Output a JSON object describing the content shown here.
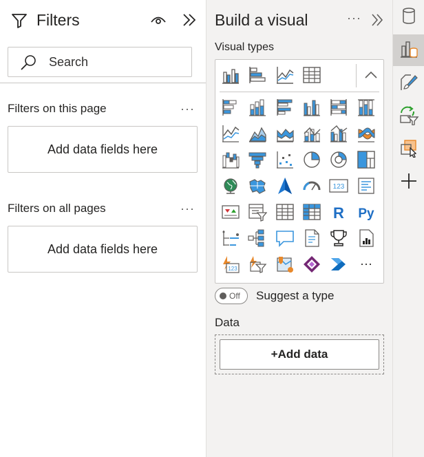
{
  "filters_pane": {
    "title": "Filters",
    "search": {
      "placeholder": "Search"
    },
    "page_section": {
      "label": "Filters on this page",
      "dropzone": "Add data fields here"
    },
    "all_pages_section": {
      "label": "Filters on all pages",
      "dropzone": "Add data fields here"
    }
  },
  "build_pane": {
    "title": "Build a visual",
    "more_label": "···",
    "visual_types_label": "Visual types",
    "pinned_visuals": [
      "clustered-column-chart",
      "stacked-bar-chart",
      "line-chart",
      "table"
    ],
    "visual_grid": [
      [
        "stacked-bar-chart",
        "stacked-column-chart",
        "clustered-bar-chart",
        "clustered-column-chart",
        "100-stacked-bar-chart",
        "100-stacked-column-chart"
      ],
      [
        "line-chart",
        "area-chart",
        "stacked-area-chart",
        "line-and-stacked-column-chart",
        "line-and-clustered-column-chart",
        "ribbon-chart"
      ],
      [
        "waterfall-chart",
        "funnel-chart",
        "scatter-chart",
        "pie-chart",
        "donut-chart",
        "treemap"
      ],
      [
        "map",
        "filled-map",
        "azure-map",
        "gauge",
        "card",
        "multi-row-card"
      ],
      [
        "kpi",
        "slicer",
        "table",
        "matrix",
        "r-script-visual",
        "python-visual"
      ],
      [
        "key-influencers",
        "decomposition-tree",
        "qa",
        "smart-narrative",
        "metrics",
        "paginated-report"
      ],
      [
        "power-apps-card",
        "power-apps-slicer",
        "arcgis-map",
        "power-apps",
        "power-automate",
        "more-visuals"
      ]
    ],
    "r_label": "R",
    "py_label": "Py",
    "card_label": "123",
    "ellipsis_label": "···",
    "suggest_toggle": {
      "state_label": "Off",
      "label": "Suggest a type"
    },
    "data_label": "Data",
    "add_data_label": "+Add data"
  },
  "right_rail": {
    "items": [
      "data-cylinder-icon",
      "build-visual-icon",
      "format-brush-icon",
      "sync-filter-icon",
      "selection-icon",
      "add-icon"
    ]
  },
  "colors": {
    "accent": "#3a96dd",
    "orange": "#e8892c",
    "gray": "#605e5c",
    "pane_bg": "#f3f2f1"
  }
}
